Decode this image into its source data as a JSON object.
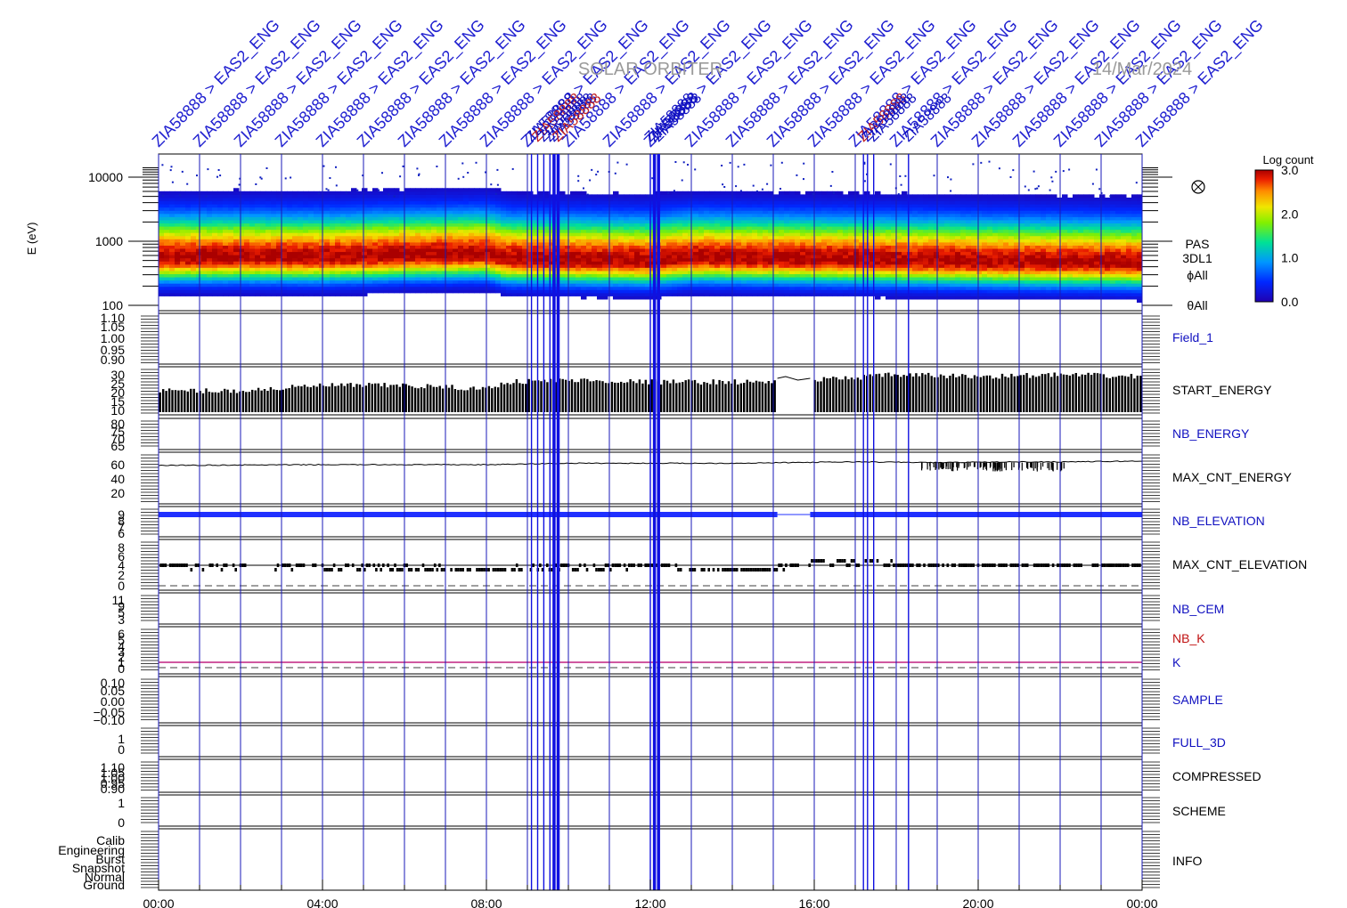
{
  "header": {
    "mission": "SOLAR ORBITER",
    "date": "14/Mar/2024",
    "event_label": "ZIA58888 > EAS2_ENG",
    "event_label_clip": "ZIA58888",
    "event_times_hours": [
      0.0,
      1.0,
      2.0,
      3.0,
      4.0,
      5.0,
      6.0,
      7.0,
      8.0,
      9.0,
      10.0,
      11.0,
      12.0,
      13.0,
      14.0,
      15.0,
      16.0,
      17.0,
      18.0,
      19.0,
      20.0,
      21.0,
      22.0,
      23.0,
      24.0
    ],
    "dense_event_times_hours": [
      9.1,
      9.25,
      9.4,
      9.55,
      9.65,
      9.75,
      12.0,
      12.1,
      12.2,
      17.2,
      17.3,
      17.45,
      18.3
    ]
  },
  "spectrogram": {
    "ylabel": "E (eV)",
    "yticks": [
      "10000",
      "1000",
      "100"
    ],
    "labels": [
      "PAS",
      "3DL1",
      "ϕAll",
      "θAll"
    ],
    "colorbar": {
      "title": "Log count",
      "ticks": [
        "3.0",
        "2.0",
        "1.0",
        "0.0"
      ],
      "colors": [
        "#ffffff",
        "#2000b0",
        "#0030ff",
        "#00b0ff",
        "#00e080",
        "#60f000",
        "#e0f000",
        "#ffb000",
        "#ff5000",
        "#e00000",
        "#a00000"
      ]
    }
  },
  "panels": [
    {
      "id": "field1",
      "label": "Field_1",
      "label_color": "#1010c0",
      "ticks": [
        "1.10",
        "1.05",
        "1.00",
        "0.95",
        "0.90"
      ]
    },
    {
      "id": "start_energy",
      "label": "START_ENERGY",
      "label_color": "#000000",
      "ticks": [
        "30",
        "25",
        "20",
        "15",
        "10"
      ]
    },
    {
      "id": "nb_energy",
      "label": "NB_ENERGY",
      "label_color": "#1010c0",
      "ticks": [
        "80",
        "75",
        "70",
        "65"
      ]
    },
    {
      "id": "max_cnt_energy",
      "label": "MAX_CNT_ENERGY",
      "label_color": "#000000",
      "ticks": [
        "60",
        "40",
        "20"
      ]
    },
    {
      "id": "nb_elevation",
      "label": "NB_ELEVATION",
      "label_color": "#1010c0",
      "ticks": [
        "9",
        "8",
        "7",
        "6"
      ]
    },
    {
      "id": "max_cnt_elevation",
      "label": "MAX_CNT_ELEVATION",
      "label_color": "#000000",
      "ticks": [
        "8",
        "6",
        "4",
        "2",
        "0"
      ]
    },
    {
      "id": "nb_cem",
      "label": "NB_CEM",
      "label_color": "#1010c0",
      "ticks": [
        "11",
        "9",
        "5",
        "3"
      ]
    },
    {
      "id": "nb_k",
      "labels": [
        "NB_K",
        "K"
      ],
      "label_colors": [
        "#c01010",
        "#1010c0"
      ],
      "ticks": [
        "6",
        "5",
        "4",
        "3",
        "2",
        "1",
        "0"
      ]
    },
    {
      "id": "sample",
      "label": "SAMPLE",
      "label_color": "#1010c0",
      "ticks": [
        "0.10",
        "0.05",
        "0.00",
        "−0.05",
        "−0.10"
      ]
    },
    {
      "id": "full_3d",
      "label": "FULL_3D",
      "label_color": "#1010c0",
      "ticks": [
        "1",
        "0"
      ]
    },
    {
      "id": "compressed",
      "label": "COMPRESSED",
      "label_color": "#000000",
      "ticks": [
        "1.10",
        "1.05",
        "1.00",
        "0.95",
        "0.90"
      ]
    },
    {
      "id": "scheme",
      "label": "SCHEME",
      "label_color": "#000000",
      "ticks": [
        "1",
        "0"
      ]
    },
    {
      "id": "info",
      "label": "INFO",
      "label_color": "#000000",
      "ticks": [
        "Calib",
        "Engineering",
        "Burst",
        "Snapshot",
        "Normal",
        "Ground"
      ]
    }
  ],
  "x_axis": {
    "ticks": [
      "00:00",
      "04:00",
      "08:00",
      "12:00",
      "16:00",
      "20:00",
      "00:00"
    ]
  },
  "chart_data": {
    "type": "heatmap",
    "title": "SOLAR ORBITER",
    "subtitle": "14/Mar/2024",
    "xlabel": "",
    "ylabel": "E (eV)",
    "x_range_hours": [
      0,
      24
    ],
    "y_scale": "log",
    "ylim": [
      100,
      15000
    ],
    "colorbar": {
      "label": "Log count",
      "range": [
        0.0,
        3.0
      ]
    },
    "peak_energy_eV": {
      "x": [
        0,
        2,
        4,
        5,
        6,
        7,
        8,
        8.5,
        10,
        12,
        13,
        15,
        17,
        19,
        21,
        24
      ],
      "values": [
        560,
        570,
        560,
        580,
        610,
        620,
        640,
        540,
        520,
        500,
        560,
        540,
        520,
        500,
        480,
        460
      ]
    },
    "series": [
      {
        "name": "START_ENERGY",
        "x": [
          0,
          2,
          4,
          6,
          8,
          8.5,
          10,
          12,
          14,
          15.2,
          15.9,
          16,
          18,
          20,
          22,
          24
        ],
        "values": [
          21,
          21,
          24,
          24,
          22,
          26,
          27,
          26,
          26,
          26,
          27,
          27,
          30,
          29,
          30,
          29
        ]
      },
      {
        "name": "MAX_CNT_ENERGY",
        "x": [
          0,
          4,
          8,
          10,
          12,
          14,
          17,
          19,
          21,
          22,
          24
        ],
        "values": [
          59,
          60,
          60,
          62,
          62,
          62,
          64,
          63,
          64,
          64,
          65
        ]
      },
      {
        "name": "NB_ELEVATION",
        "x": [
          0,
          15.2,
          15.9,
          24
        ],
        "values": [
          9,
          9,
          9,
          9
        ]
      },
      {
        "name": "MAX_CNT_ELEVATION",
        "x": [
          0,
          8.5,
          12,
          13,
          15,
          16,
          18,
          20,
          24
        ],
        "values": [
          4,
          3,
          4,
          3,
          3,
          5,
          4,
          4,
          4
        ]
      },
      {
        "name": "K",
        "x": [
          0,
          24
        ],
        "values": [
          1,
          1
        ]
      },
      {
        "name": "FULL_3D",
        "x": [
          0,
          24
        ],
        "values": [
          0,
          0
        ]
      },
      {
        "name": "SCHEME",
        "x": [
          0,
          24
        ],
        "values": [
          0,
          0
        ]
      }
    ]
  }
}
